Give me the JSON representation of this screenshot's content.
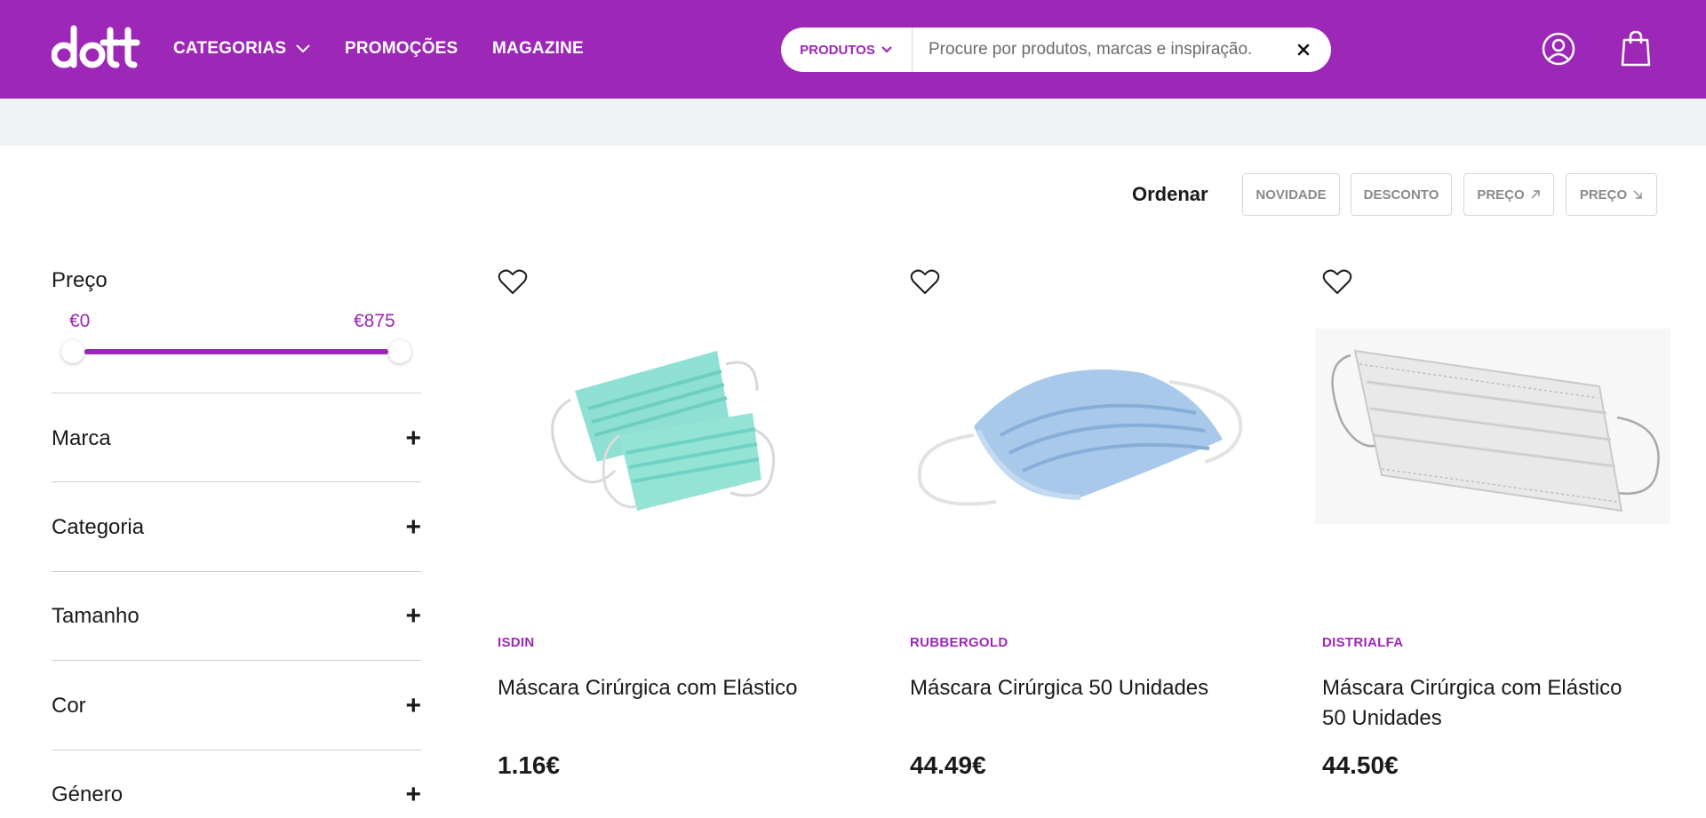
{
  "header": {
    "logo_text": "dott",
    "nav": [
      {
        "label": "CATEGORIAS",
        "icon": "chevron-down-icon"
      },
      {
        "label": "PROMOÇÕES"
      },
      {
        "label": "MAGAZINE"
      }
    ],
    "search": {
      "type_label": "PRODUTOS",
      "placeholder": "Procure por produtos, marcas e inspiração.",
      "value": ""
    },
    "icons": [
      "user-icon",
      "shopping-bag-icon",
      "close-icon"
    ]
  },
  "colors": {
    "brand": "#9d27b6",
    "subband": "#eff3f6",
    "text": "#1a1a1a",
    "muted": "#8a8a8a"
  },
  "sort": {
    "label": "Ordenar",
    "options": [
      {
        "label": "NOVIDADE"
      },
      {
        "label": "DESCONTO"
      },
      {
        "label": "PREÇO",
        "icon": "arrow-up-right-icon"
      },
      {
        "label": "PREÇO",
        "icon": "arrow-down-right-icon"
      }
    ]
  },
  "filters": {
    "price": {
      "title": "Preço",
      "min_label": "€0",
      "max_label": "€875",
      "range_min_fraction": 0.0,
      "range_max_fraction": 1.0
    },
    "sections": [
      {
        "label": "Marca",
        "toggle": "+"
      },
      {
        "label": "Categoria",
        "toggle": "+"
      },
      {
        "label": "Tamanho",
        "toggle": "+"
      },
      {
        "label": "Cor",
        "toggle": "+"
      },
      {
        "label": "Género",
        "toggle": "+"
      }
    ]
  },
  "products": [
    {
      "brand": "ISDIN",
      "name": "Máscara Cirúrgica com Elástico",
      "price": "1.16€",
      "image": "green-surgical-masks"
    },
    {
      "brand": "RUBBERGOLD",
      "name": "Máscara Cirúrgica 50 Unidades",
      "price": "44.49€",
      "image": "blue-surgical-mask"
    },
    {
      "brand": "DISTRIALFA",
      "name": "Máscara Cirúrgica com Elástico 50 Unidades",
      "price": "44.50€",
      "image": "white-surgical-mask"
    }
  ]
}
